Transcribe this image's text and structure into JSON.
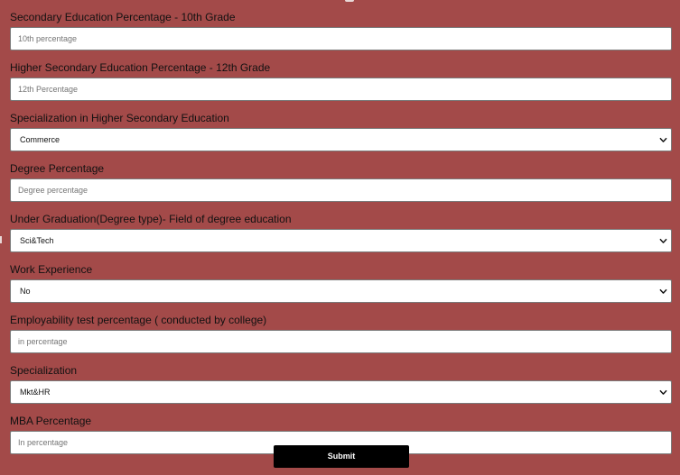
{
  "form": {
    "fields": [
      {
        "label": "Secondary Education Percentage - 10th Grade",
        "type": "text",
        "placeholder": "10th percentage",
        "value": ""
      },
      {
        "label": "Higher Secondary Education Percentage - 12th Grade",
        "type": "text",
        "placeholder": "12th Percentage",
        "value": ""
      },
      {
        "label": "Specialization in Higher Secondary Education",
        "type": "select",
        "value": "Commerce"
      },
      {
        "label": "Degree Percentage",
        "type": "text",
        "placeholder": "Degree percentage",
        "value": ""
      },
      {
        "label": "Under Graduation(Degree type)- Field of degree education",
        "type": "select",
        "value": "Sci&Tech"
      },
      {
        "label": "Work Experience",
        "type": "select",
        "value": "No"
      },
      {
        "label": "Employability test percentage ( conducted by college)",
        "type": "text",
        "placeholder": "in percentage",
        "value": ""
      },
      {
        "label": "Specialization",
        "type": "select",
        "value": "Mkt&HR"
      },
      {
        "label": "MBA Percentage",
        "type": "text",
        "placeholder": "In percentage",
        "value": ""
      }
    ],
    "submit_label": "Submit"
  },
  "colors": {
    "page_background": "#a34a49",
    "input_background": "#ffffff",
    "button_background": "#000000",
    "button_text": "#ffffff"
  },
  "icons": {
    "select_indicator": "chevron-down-icon"
  }
}
